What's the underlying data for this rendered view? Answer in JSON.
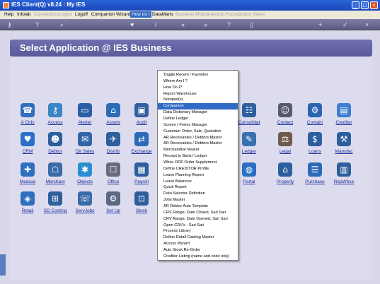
{
  "window": {
    "title": "IES Client(Q) v8.24 : My IES"
  },
  "menubar": [
    {
      "label": "Help",
      "state": "normal"
    },
    {
      "label": "Infolab",
      "state": "normal"
    },
    {
      "label": "Connections",
      "state": "disabled"
    },
    {
      "label": "Logon",
      "state": "disabled"
    },
    {
      "label": "Logoff",
      "state": "normal"
    },
    {
      "label": "Companion",
      "state": "normal"
    },
    {
      "label": "Wizard",
      "state": "normal"
    },
    {
      "label": "How do I",
      "state": "active"
    },
    {
      "label": "DataMarts",
      "state": "normal"
    },
    {
      "label": "Business Modules",
      "state": "disabled"
    },
    {
      "label": "Action Focus",
      "state": "disabled"
    },
    {
      "label": "Option Select",
      "state": "disabled"
    }
  ],
  "toolbar_icons": [
    "key-icon",
    "help-icon",
    "search-icon",
    "heart-icon",
    "info-icon",
    "double-left-icon",
    "double-right-icon",
    "question-icon",
    "lock-icon",
    "add-icon",
    "check-icon",
    "close-icon"
  ],
  "header": {
    "title": "Select Application @ IES Business"
  },
  "apps": [
    {
      "label": "A Ctrls",
      "icon": "a-ctrls-icon",
      "glyph": "☎",
      "color": "#2f6fbf"
    },
    {
      "label": "Access",
      "icon": "key-icon",
      "glyph": "⚷",
      "color": "#3b86c8"
    },
    {
      "label": "Alerter",
      "icon": "alerter-icon",
      "glyph": "▭",
      "color": "#2a5fa5"
    },
    {
      "label": "Assets",
      "icon": "house-icon",
      "glyph": "⌂",
      "color": "#2c6db8"
    },
    {
      "label": "Audit",
      "icon": "monitor-icon",
      "glyph": "▣",
      "color": "#345fa0"
    },
    {
      "label": "Consolidat",
      "icon": "org-chart-icon",
      "glyph": "☷",
      "color": "#2d5f9e"
    },
    {
      "label": "Contact",
      "icon": "people-icon",
      "glyph": "☺",
      "color": "#555a70"
    },
    {
      "label": "Contain",
      "icon": "gears-icon",
      "glyph": "⚙",
      "color": "#2a66b0"
    },
    {
      "label": "Creditor",
      "icon": "creditor-icon",
      "glyph": "▤",
      "color": "#3d7ed0"
    },
    {
      "label": "CRM",
      "icon": "heart-icon",
      "glyph": "♥",
      "color": "#2a70c8"
    },
    {
      "label": "Debtor",
      "icon": "debtor-icon",
      "glyph": "☻",
      "color": "#2d5f9e"
    },
    {
      "label": "Dir Sales",
      "icon": "dir-sales-icon",
      "glyph": "✉",
      "color": "#3366a8"
    },
    {
      "label": "Distrib",
      "icon": "distrib-icon",
      "glyph": "✈",
      "color": "#2d5f9e"
    },
    {
      "label": "Exchange",
      "icon": "exchange-icon",
      "glyph": "⇄",
      "color": "#2c6ab8"
    },
    {
      "label": "Ledger",
      "icon": "ledger-icon",
      "glyph": "✎",
      "color": "#3a6fb0"
    },
    {
      "label": "Legal",
      "icon": "legal-icon",
      "glyph": "⚖",
      "color": "#6d5a4a"
    },
    {
      "label": "Loans",
      "icon": "loans-icon",
      "glyph": "$",
      "color": "#2d5f9e"
    },
    {
      "label": "Manufac",
      "icon": "manufac-icon",
      "glyph": "⚒",
      "color": "#2d5f9e"
    },
    {
      "label": "Medical",
      "icon": "medical-icon",
      "glyph": "✚",
      "color": "#2f6fbf"
    },
    {
      "label": "Merchant",
      "icon": "merchant-icon",
      "glyph": "☖",
      "color": "#3b6aa8"
    },
    {
      "label": "Objects",
      "icon": "objects-icon",
      "glyph": "✱",
      "color": "#2a8fd0"
    },
    {
      "label": "Office",
      "icon": "office-icon",
      "glyph": "☐",
      "color": "#6a6a80"
    },
    {
      "label": "Payroll",
      "icon": "payroll-icon",
      "glyph": "▦",
      "color": "#2d5f9e"
    },
    {
      "label": "Portal",
      "icon": "globe-icon",
      "glyph": "◍",
      "color": "#2a6fc0"
    },
    {
      "label": "Property",
      "icon": "property-icon",
      "glyph": "⌂",
      "color": "#2d5f9e"
    },
    {
      "label": "Purchase",
      "icon": "purchase-icon",
      "glyph": "☰",
      "color": "#2c6ab8"
    },
    {
      "label": "RepWhse",
      "icon": "repwhse-icon",
      "glyph": "▥",
      "color": "#2d5f9e"
    },
    {
      "label": "Retail",
      "icon": "retail-icon",
      "glyph": "◈",
      "color": "#2f6fbf"
    },
    {
      "label": "SD Costing",
      "icon": "sd-costing-icon",
      "glyph": "⊞",
      "color": "#2d5f9e"
    },
    {
      "label": "ServJobs",
      "icon": "servjobs-icon",
      "glyph": "☏",
      "color": "#3a6aa8"
    },
    {
      "label": "Set Up",
      "icon": "setup-icon",
      "glyph": "⚙",
      "color": "#5a6a80"
    },
    {
      "label": "Stock",
      "icon": "cart-icon",
      "glyph": "⊡",
      "color": "#2d5f9e"
    }
  ],
  "dropdown": {
    "items": [
      "Toggle Recent / Favorites",
      "Where Am I ?",
      "How Do I?",
      "Report Warehouse",
      "Notepad(s)",
      "Companion",
      "Data Dictionary Manager",
      "Define Ledger",
      "Screen / Forms Manager",
      "Customer Order, Sale, Quotation",
      "AR Receivables / Debtors Master",
      "AR Receivables / Debtors Master",
      "Merchandise Master",
      "Receipt to Bank / Ledger",
      "Whse ODP Order Supplement",
      "Define CREDITOR Profile",
      "Leave Planning Report",
      "Leave Balances",
      "Quick Report",
      "Data Selector Definition",
      "Jobs Master",
      "AR Debtor Auto Template",
      "CRV Range, Date Closed, Sari Sari",
      "CRV Range, Date Opened, Sari Sari",
      "Open CRV's - Sari Sari",
      "Process Library",
      "Define Retail Catalog Master",
      "Access Wizard",
      "Auto Stock Re-Order",
      "Creditor Listing (name and code only)"
    ],
    "highlighted": "Companion"
  },
  "colors": {
    "title_bar": "#1a47b8",
    "menu_highlight": "#316ac5",
    "header": "#6464a8",
    "link": "#1a2a9a"
  }
}
